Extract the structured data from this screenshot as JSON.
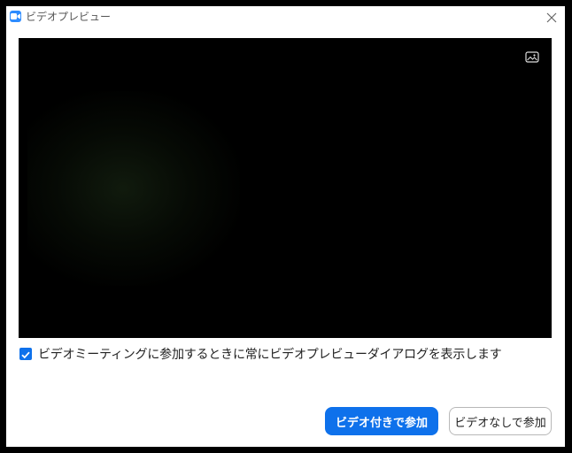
{
  "window": {
    "title": "ビデオプレビュー"
  },
  "icons": {
    "app": "zoom-camera-icon",
    "close": "close-icon",
    "background": "virtual-background-icon"
  },
  "options": {
    "show_preview_label": "ビデオミーティングに参加するときに常にビデオプレビューダイアログを表示します",
    "show_preview_checked": true
  },
  "actions": {
    "join_with_video": "ビデオ付きで参加",
    "join_without_video": "ビデオなしで参加"
  },
  "colors": {
    "accent": "#0e71eb",
    "app_icon": "#2d8cff"
  }
}
